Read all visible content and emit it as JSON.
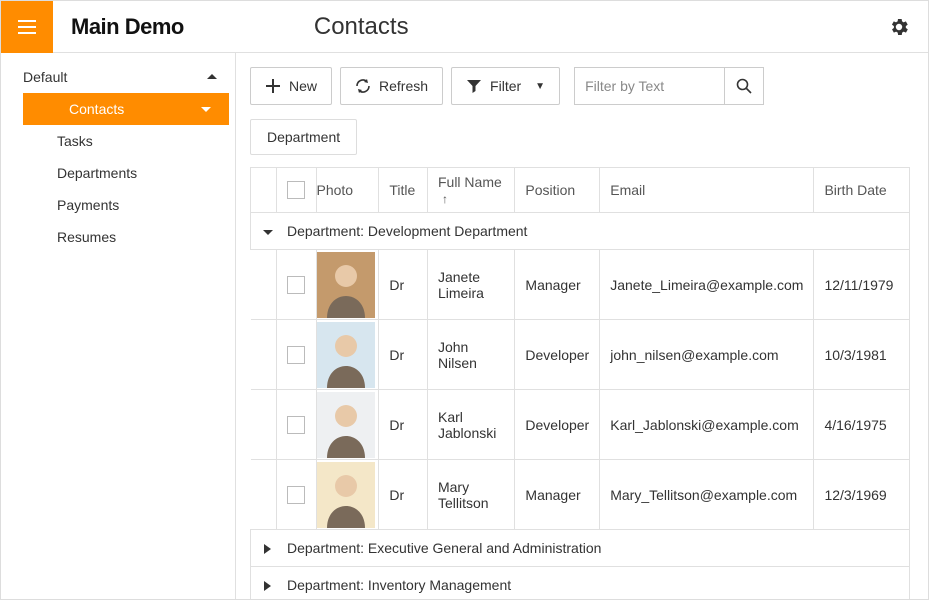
{
  "header": {
    "app_title": "Main Demo",
    "page_title": "Contacts"
  },
  "sidebar": {
    "group_label": "Default",
    "items": [
      {
        "label": "Contacts",
        "active": true,
        "has_children": true
      },
      {
        "label": "Tasks"
      },
      {
        "label": "Departments"
      },
      {
        "label": "Payments"
      },
      {
        "label": "Resumes"
      }
    ]
  },
  "toolbar": {
    "new_label": "New",
    "refresh_label": "Refresh",
    "filter_label": "Filter",
    "search_placeholder": "Filter by Text"
  },
  "group_panel": {
    "chip": "Department"
  },
  "columns": {
    "photo": "Photo",
    "title": "Title",
    "full_name": "Full Name",
    "position": "Position",
    "email": "Email",
    "birth_date": "Birth Date",
    "sort_column": "full_name",
    "sort_dir": "asc"
  },
  "groups": [
    {
      "label": "Department: Development Department",
      "expanded": true,
      "rows": [
        {
          "title": "Dr",
          "full_name": "Janete Limeira",
          "position": "Manager",
          "email": "Janete_Limeira@example.com",
          "birth_date": "12/11/1979",
          "photo_bg": "#c49a6c"
        },
        {
          "title": "Dr",
          "full_name": "John Nilsen",
          "position": "Developer",
          "email": "john_nilsen@example.com",
          "birth_date": "10/3/1981",
          "photo_bg": "#d7e6ef"
        },
        {
          "title": "Dr",
          "full_name": "Karl Jablonski",
          "position": "Developer",
          "email": "Karl_Jablonski@example.com",
          "birth_date": "4/16/1975",
          "photo_bg": "#eef0f2"
        },
        {
          "title": "Dr",
          "full_name": "Mary Tellitson",
          "position": "Manager",
          "email": "Mary_Tellitson@example.com",
          "birth_date": "12/3/1969",
          "photo_bg": "#f4e7c8"
        }
      ]
    },
    {
      "label": "Department: Executive General and Administration",
      "expanded": false,
      "rows": []
    },
    {
      "label": "Department: Inventory Management",
      "expanded": false,
      "rows": []
    }
  ]
}
